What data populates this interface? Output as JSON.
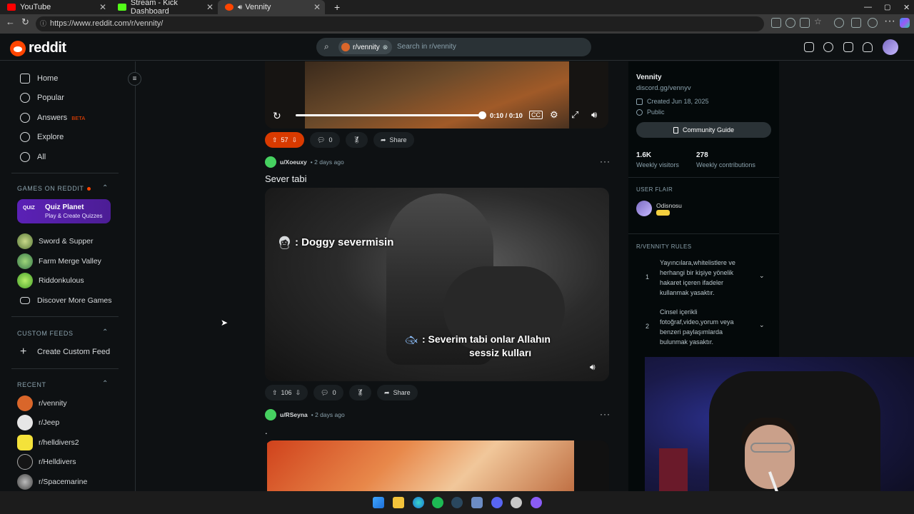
{
  "browser": {
    "tabs": [
      {
        "title": "YouTube",
        "color": "#ff0000"
      },
      {
        "title": "Stream - Kick Dashboard",
        "color": "#53fc18"
      },
      {
        "title": "Vennity",
        "color": "#ff4500"
      }
    ],
    "url": "https://www.reddit.com/r/vennity/"
  },
  "header": {
    "logo_text": "reddit",
    "search_chip": "r/vennity",
    "search_placeholder": "Search in r/vennity"
  },
  "sidebar": {
    "nav": [
      "Home",
      "Popular",
      "Answers",
      "Explore",
      "All"
    ],
    "answers_badge": "BETA",
    "games_title": "GAMES ON REDDIT",
    "quiz_title": "Quiz Planet",
    "quiz_sub": "Play & Create Quizzes",
    "quiz_icon_text": "QUIZ",
    "games": [
      "Sword & Supper",
      "Farm Merge Valley",
      "Riddonkulous",
      "Discover More Games"
    ],
    "custom_feeds_title": "CUSTOM FEEDS",
    "create_feed": "Create Custom Feed",
    "recent_title": "RECENT",
    "recent": [
      "r/vennity",
      "r/Jeep",
      "r/helldivers2",
      "r/Helldivers",
      "r/Spacemarine"
    ]
  },
  "video1": {
    "time": "0:10 / 0:10",
    "upvotes": "57",
    "comments": "0",
    "share": "Share",
    "progress": 1.0
  },
  "post2": {
    "user": "u/Xoeuxy",
    "time": "• 2 days ago",
    "title": "Sever tabi",
    "caption1": ": Doggy severmisin",
    "caption2": ": Severim tabi onlar Allahın",
    "caption3": "sessiz kulları",
    "upvotes": "106",
    "comments": "0",
    "share": "Share"
  },
  "post3": {
    "user": "u/RSeyna",
    "time": "• 2 days ago",
    "title": "."
  },
  "community": {
    "name": "Vennity",
    "link": "discord.gg/vennyv",
    "created": "Created Jun 18, 2025",
    "visibility": "Public",
    "guide": "Community Guide",
    "visitors": "1.6K",
    "visitors_label": "Weekly visitors",
    "contributions": "278",
    "contributions_label": "Weekly contributions",
    "flair_title": "USER FLAIR",
    "flair_user": "Odisnosu",
    "rules_title": "R/VENNITY RULES",
    "rules": [
      {
        "num": "1",
        "text": "Yayıncılara,whitelistlere ve herhangi bir kişiye yönelik hakaret içeren ifadeler kullanmak yasaktır."
      },
      {
        "num": "2",
        "text": "Cinsel içerikli fotoğraf,video,yorum veya benzeri paylaşımlarda bulunmak yasaktır."
      }
    ]
  },
  "colors": {
    "accent": "#ff4500",
    "bg": "#0e1113",
    "panel": "#04090a"
  }
}
